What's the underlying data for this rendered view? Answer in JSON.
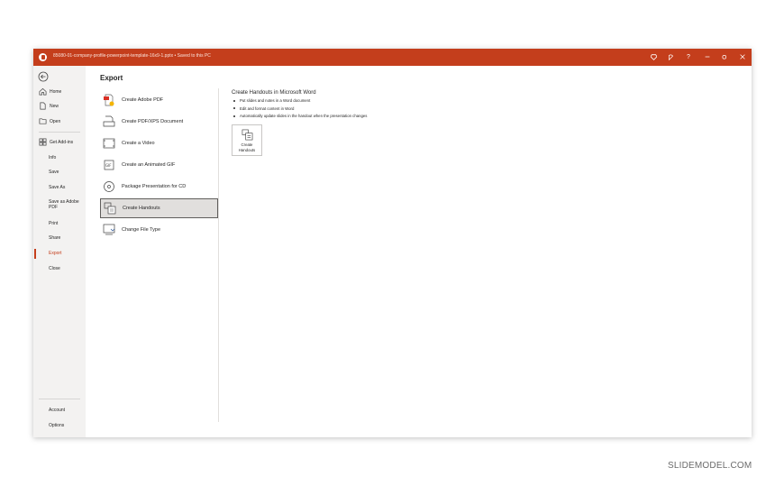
{
  "titlebar": {
    "title": "85080-01-company-profile-powerpoint-template-16x9-1.pptx • Saved to this PC",
    "color": "#c43e1c"
  },
  "leftnav": {
    "top_items": [
      {
        "label": "Home",
        "icon": "home-icon"
      },
      {
        "label": "New",
        "icon": "new-document-icon"
      },
      {
        "label": "Open",
        "icon": "folder-open-icon"
      }
    ],
    "addins": {
      "label": "Get Add-ins",
      "icon": "add-ins-icon"
    },
    "items": [
      "Info",
      "Save",
      "Save As",
      "Save as Adobe PDF",
      "Print",
      "Share",
      "Export",
      "Close"
    ],
    "active": "Export",
    "bottom_items": [
      "Account",
      "Options"
    ]
  },
  "export": {
    "title": "Export",
    "options": [
      {
        "label": "Create Adobe PDF",
        "icon": "adobe-pdf-icon"
      },
      {
        "label": "Create PDF/XPS Document",
        "icon": "pdf-xps-icon"
      },
      {
        "label": "Create a Video",
        "icon": "video-icon"
      },
      {
        "label": "Create an Animated GIF",
        "icon": "gif-icon"
      },
      {
        "label": "Package Presentation for CD",
        "icon": "cd-icon"
      },
      {
        "label": "Create Handouts",
        "icon": "handouts-icon"
      },
      {
        "label": "Change File Type",
        "icon": "file-type-icon"
      }
    ],
    "selected": "Create Handouts"
  },
  "detail": {
    "title": "Create Handouts in Microsoft Word",
    "bullets": [
      "Put slides and notes in a Word document",
      "Edit and format content in Word",
      "Automatically update slides in the handout when the presentation changes"
    ],
    "button_line1": "Create",
    "button_line2": "Handouts"
  },
  "watermark": "SLIDEMODEL.COM"
}
